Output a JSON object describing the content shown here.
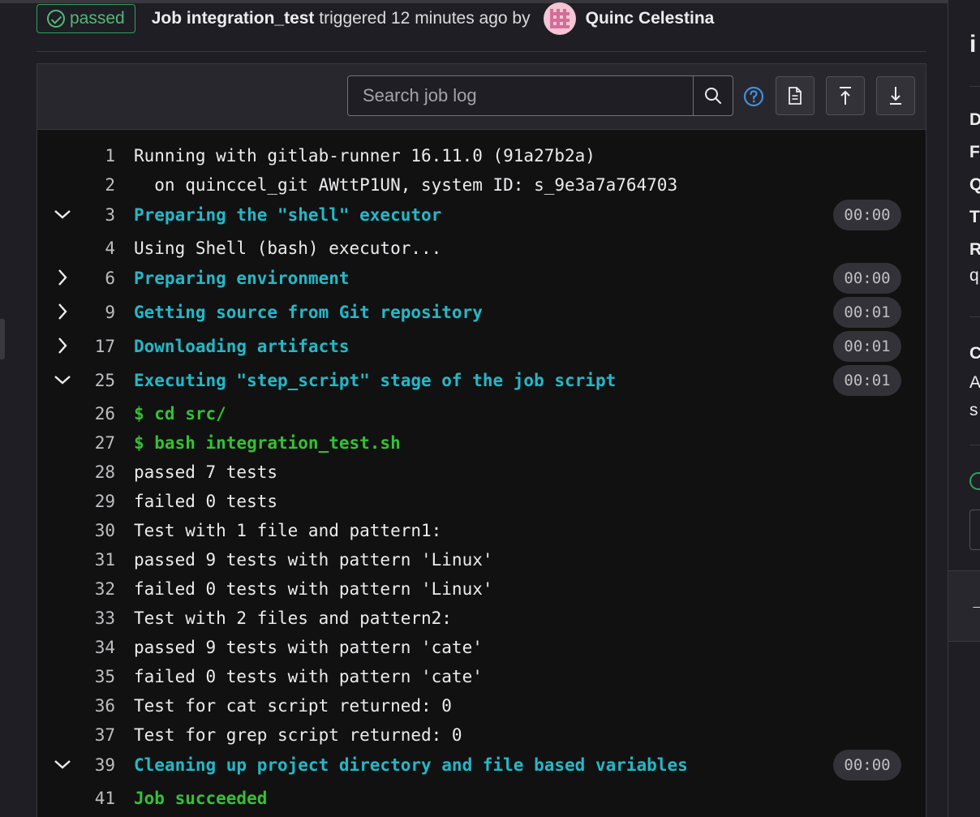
{
  "header": {
    "status": "passed",
    "job_prefix": "Job",
    "job_name": "integration_test",
    "triggered": "triggered 12 minutes ago by",
    "user": "Quinc Celestina"
  },
  "toolbar": {
    "search_placeholder": "Search job log"
  },
  "log": [
    {
      "n": "1",
      "text": "Running with gitlab-runner 16.11.0 (91a27b2a)",
      "kind": "plain"
    },
    {
      "n": "2",
      "text": "  on quinccel_git AWttP1UN, system ID: s_9e3a7a764703",
      "kind": "plain"
    },
    {
      "n": "3",
      "text": "Preparing the \"shell\" executor",
      "kind": "section",
      "chevron": "down",
      "duration": "00:00"
    },
    {
      "n": "4",
      "text": "Using Shell (bash) executor...",
      "kind": "plain"
    },
    {
      "n": "6",
      "text": "Preparing environment",
      "kind": "section",
      "chevron": "right",
      "duration": "00:00"
    },
    {
      "n": "9",
      "text": "Getting source from Git repository",
      "kind": "section",
      "chevron": "right",
      "duration": "00:01"
    },
    {
      "n": "17",
      "text": "Downloading artifacts",
      "kind": "section",
      "chevron": "right",
      "duration": "00:01"
    },
    {
      "n": "25",
      "text": "Executing \"step_script\" stage of the job script",
      "kind": "section",
      "chevron": "down",
      "duration": "00:01"
    },
    {
      "n": "26",
      "text": "$ cd src/",
      "kind": "cmd"
    },
    {
      "n": "27",
      "text": "$ bash integration_test.sh",
      "kind": "cmd"
    },
    {
      "n": "28",
      "text": "passed 7 tests",
      "kind": "plain"
    },
    {
      "n": "29",
      "text": "failed 0 tests",
      "kind": "plain"
    },
    {
      "n": "30",
      "text": "Test with 1 file and pattern1:",
      "kind": "plain"
    },
    {
      "n": "31",
      "text": "passed 9 tests with pattern 'Linux'",
      "kind": "plain"
    },
    {
      "n": "32",
      "text": "failed 0 tests with pattern 'Linux'",
      "kind": "plain"
    },
    {
      "n": "33",
      "text": "Test with 2 files and pattern2:",
      "kind": "plain"
    },
    {
      "n": "34",
      "text": "passed 9 tests with pattern 'cate'",
      "kind": "plain"
    },
    {
      "n": "35",
      "text": "failed 0 tests with pattern 'cate'",
      "kind": "plain"
    },
    {
      "n": "36",
      "text": "Test for cat script returned: 0",
      "kind": "plain"
    },
    {
      "n": "37",
      "text": "Test for grep script returned: 0",
      "kind": "plain"
    },
    {
      "n": "39",
      "text": "Cleaning up project directory and file based variables",
      "kind": "section",
      "chevron": "down",
      "duration": "00:00"
    },
    {
      "n": "41",
      "text": "Job succeeded",
      "kind": "cmd"
    }
  ],
  "sidebar": {
    "title_fragment": "i",
    "rows": [
      "D",
      "F",
      "Q",
      "T",
      "R"
    ],
    "row_value_fragment": "q",
    "section_fragment": "C",
    "desc_fragment_1": "A",
    "desc_fragment_2": "s",
    "arrow_fragment": "→"
  },
  "colors": {
    "success": "#52b87a",
    "section": "#24b8c8",
    "command": "#35c035",
    "log_bg": "#111111"
  }
}
